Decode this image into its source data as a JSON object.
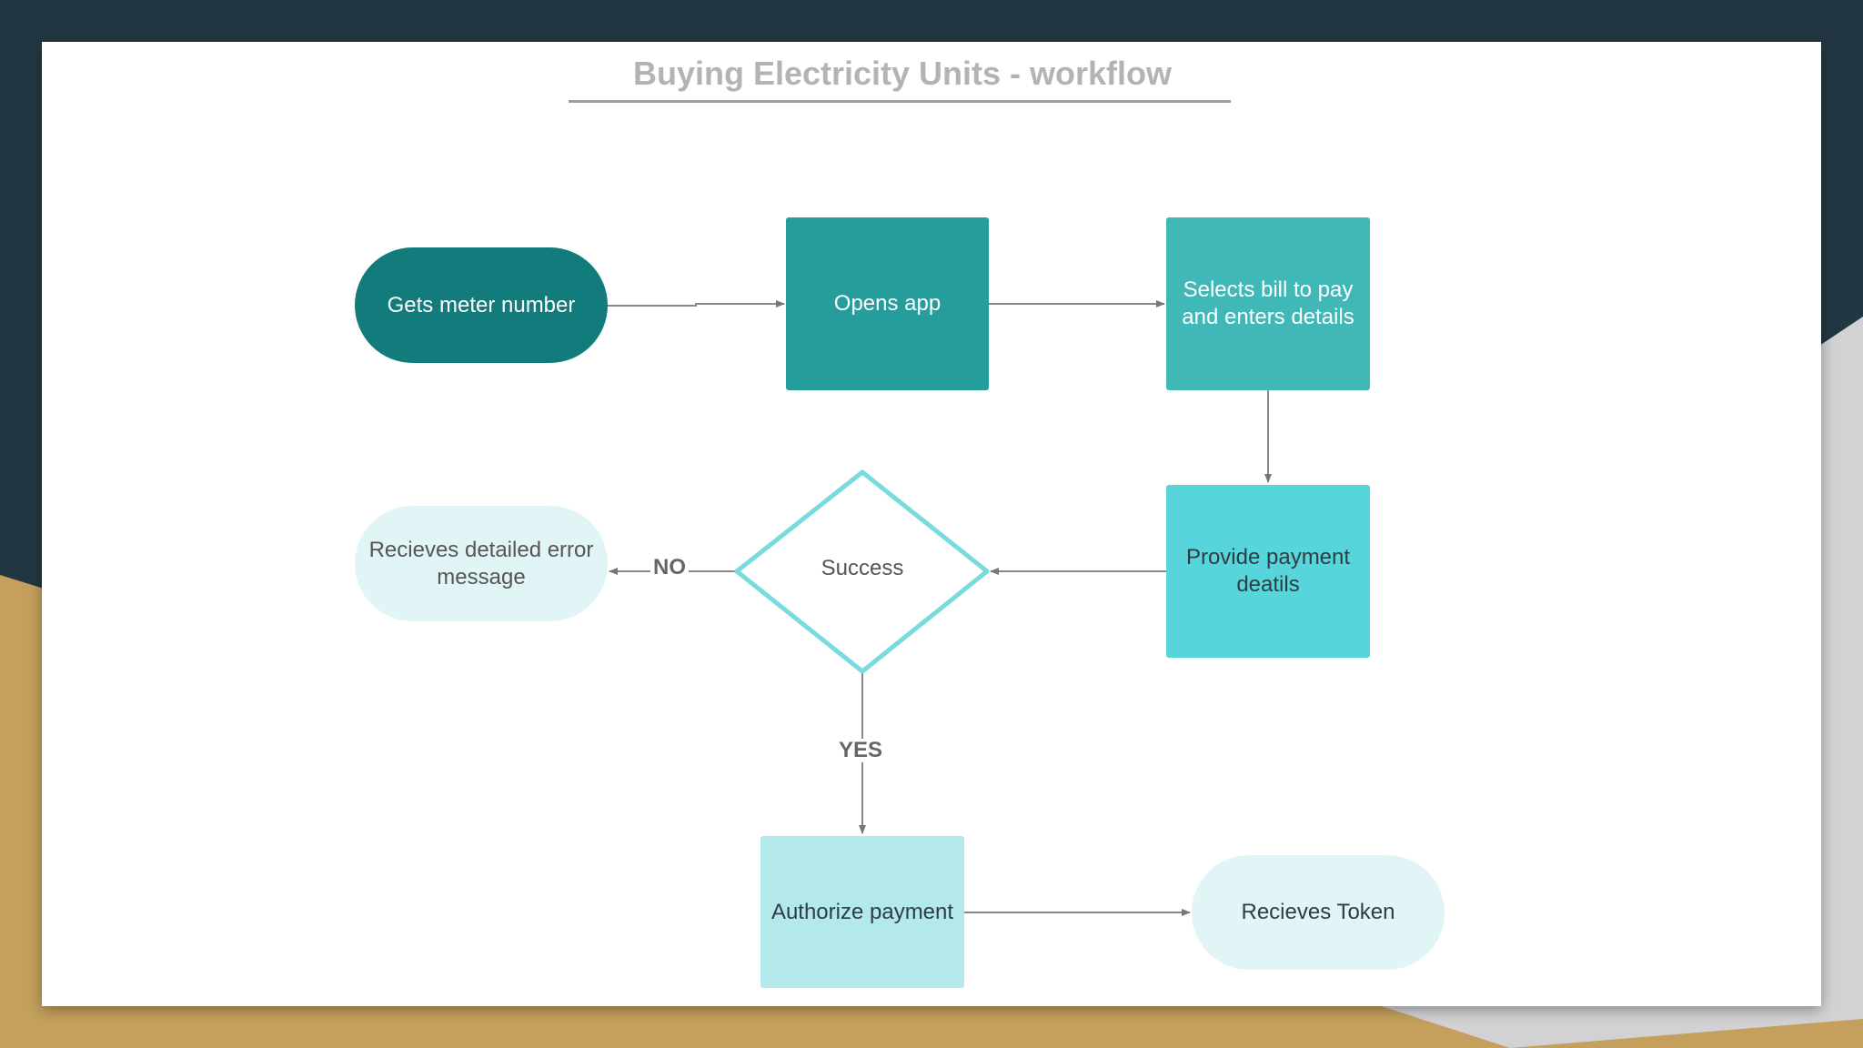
{
  "diagram": {
    "title": "Buying Electricity Units - workflow",
    "nodes": {
      "gets_meter": "Gets meter number",
      "opens_app": "Opens app",
      "selects_bill": "Selects bill to pay and enters details",
      "provide_payment": "Provide payment deatils",
      "success": "Success",
      "error_message": "Recieves detailed error message",
      "authorize_payment": "Authorize payment",
      "recieves_token": "Recieves Token"
    },
    "edge_labels": {
      "no": "NO",
      "yes": "YES"
    },
    "colors": {
      "background_dark": "#233743",
      "background_gold": "#c4a05c",
      "dark_teal": "#127b7b",
      "teal": "#259d9d",
      "mid_teal": "#40b8b8",
      "cyan": "#58d5da",
      "light_cyan": "#b3e9ea",
      "pale_cyan": "#e1f5f6",
      "diamond_border": "#7adbde",
      "arrow": "#777777"
    }
  }
}
